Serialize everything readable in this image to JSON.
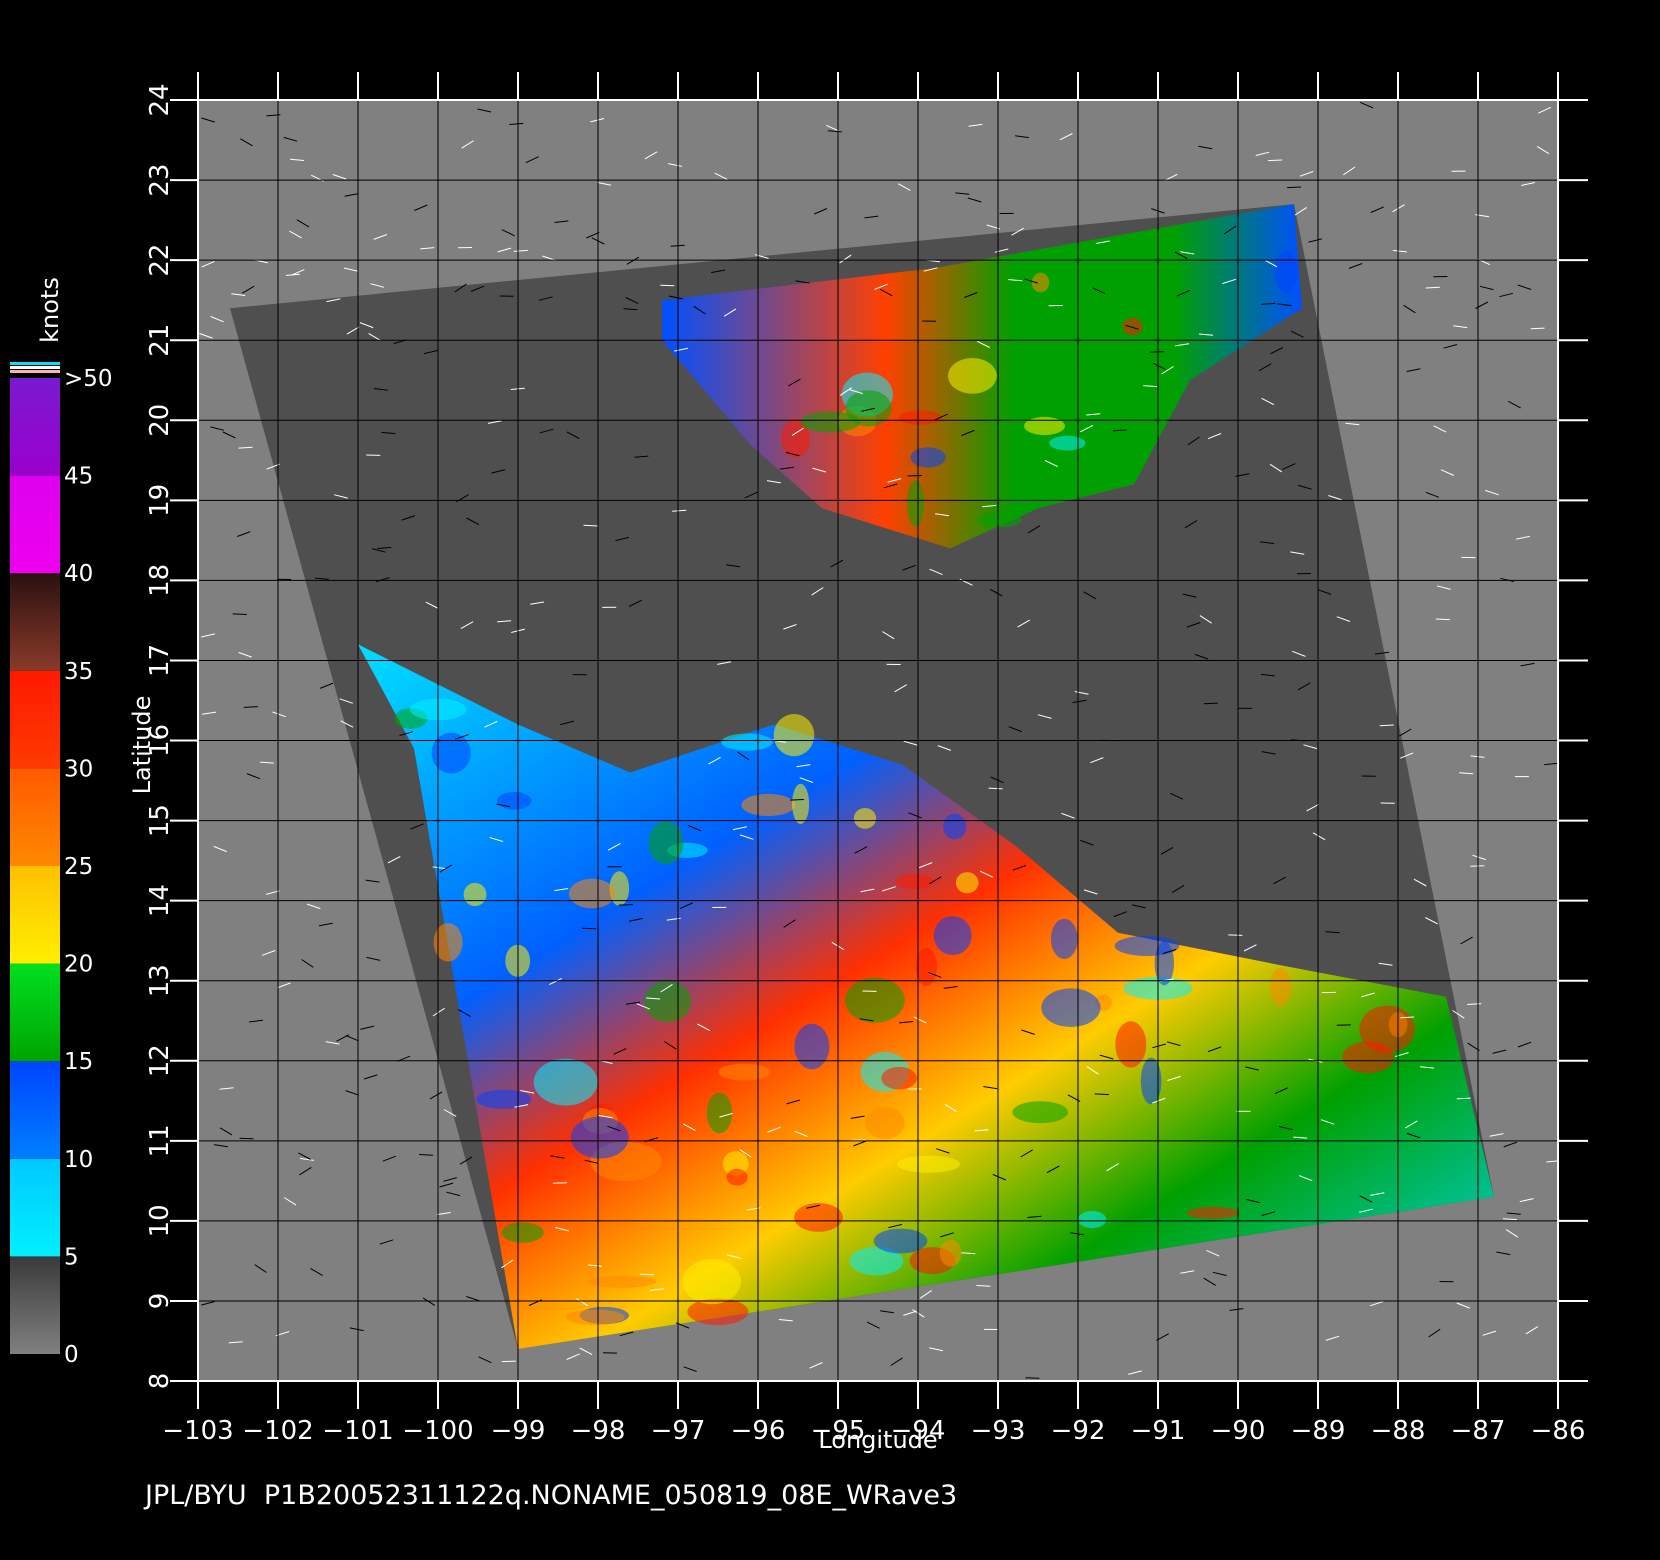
{
  "footer": {
    "credit": "JPL/BYU",
    "product": "P1B20052311122q.NONAME_050819_08E_WRave3"
  },
  "axes": {
    "xlabel": "Longitude",
    "ylabel": "Latitude",
    "lon_range": [
      -103,
      -86
    ],
    "lat_range": [
      8,
      24
    ],
    "lon_ticks": [
      "−103",
      "−102",
      "−101",
      "−100",
      "−99",
      "−98",
      "−97",
      "−96",
      "−95",
      "−94",
      "−93",
      "−92",
      "−91",
      "−90",
      "−89",
      "−88",
      "−87",
      "−86"
    ],
    "lat_ticks": [
      "8",
      "9",
      "10",
      "11",
      "12",
      "13",
      "14",
      "15",
      "16",
      "17",
      "18",
      "19",
      "20",
      "21",
      "22",
      "23",
      "24"
    ]
  },
  "colorbar": {
    "title": "knots",
    "labels": [
      "0",
      "5",
      "10",
      "15",
      "20",
      "25",
      "30",
      "35",
      "40",
      "45",
      ">50"
    ],
    "colors": {
      "land": "#4f4f4f",
      "background": "#808080",
      "cyan": "#00f0ff",
      "blue": "#0044ff",
      "green": "#00a400",
      "yellow": "#ffee00",
      "orange": "#ff8800",
      "red": "#ff1a00",
      "brown": "#8a3a2a",
      "magenta": "#ee00ee",
      "purple": "#7a1ad0"
    }
  },
  "map_data": {
    "projection": "equirectangular",
    "swath_corners_deg": [
      [
        -102.6,
        21.4
      ],
      [
        -89.3,
        22.7
      ],
      [
        -86.8,
        10.3
      ],
      [
        -99.0,
        8.4
      ]
    ],
    "northern_wind_region_deg": [
      [
        -97.2,
        21.5
      ],
      [
        -93.8,
        21.9
      ],
      [
        -89.3,
        22.7
      ],
      [
        -89.2,
        21.4
      ],
      [
        -90.6,
        20.5
      ],
      [
        -91.3,
        19.2
      ],
      [
        -92.5,
        18.9
      ],
      [
        -93.6,
        18.4
      ],
      [
        -95.2,
        18.9
      ],
      [
        -96.1,
        19.7
      ],
      [
        -97.2,
        21.0
      ]
    ],
    "southern_wind_region_deg": [
      [
        -101.0,
        17.2
      ],
      [
        -99.0,
        16.2
      ],
      [
        -97.6,
        15.6
      ],
      [
        -95.8,
        16.2
      ],
      [
        -94.2,
        15.7
      ],
      [
        -92.8,
        14.7
      ],
      [
        -91.5,
        13.6
      ],
      [
        -89.5,
        13.2
      ],
      [
        -87.4,
        12.8
      ],
      [
        -86.8,
        10.3
      ],
      [
        -99.0,
        8.4
      ],
      [
        -100.3,
        15.9
      ]
    ]
  }
}
